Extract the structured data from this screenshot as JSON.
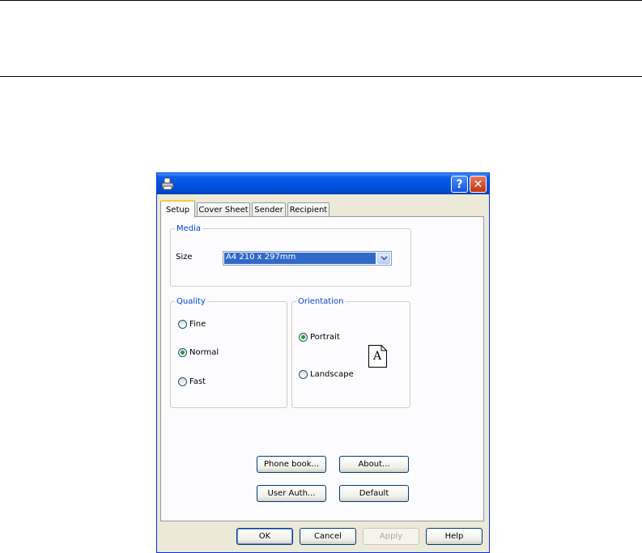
{
  "dialog": {
    "title": "",
    "help_button": "?",
    "close_button": "✕"
  },
  "tabs": [
    {
      "label": "Setup",
      "active": true
    },
    {
      "label": "Cover Sheet",
      "active": false
    },
    {
      "label": "Sender",
      "active": false
    },
    {
      "label": "Recipient",
      "active": false
    }
  ],
  "media": {
    "legend": "Media",
    "size_label": "Size",
    "size_value": "A4 210 x 297mm"
  },
  "quality": {
    "legend": "Quality",
    "options": [
      {
        "label": "Fine",
        "checked": false
      },
      {
        "label": "Normal",
        "checked": true
      },
      {
        "label": "Fast",
        "checked": false
      }
    ]
  },
  "orientation": {
    "legend": "Orientation",
    "options": [
      {
        "label": "Portrait",
        "checked": true
      },
      {
        "label": "Landscape",
        "checked": false
      }
    ],
    "preview_letter": "A"
  },
  "panel_buttons": {
    "phone_book": "Phone book...",
    "about": "About...",
    "user_auth": "User Auth...",
    "default": "Default"
  },
  "footer_buttons": {
    "ok": "OK",
    "cancel": "Cancel",
    "apply": "Apply",
    "help": "Help"
  },
  "colors": {
    "titlebar": "#0054e3",
    "group_legend": "#0046d5",
    "selection": "#316ac5",
    "radio_dot": "#21a121"
  }
}
